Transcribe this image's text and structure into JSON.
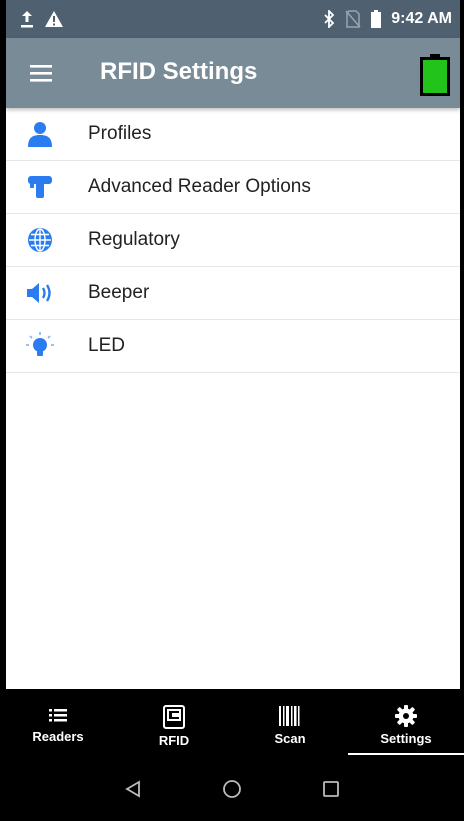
{
  "status_bar": {
    "time": "9:42 AM",
    "icons": [
      "upload-icon",
      "warning-icon",
      "bluetooth-icon",
      "no-sim-icon",
      "battery-icon"
    ]
  },
  "app_bar": {
    "title": "RFID Settings",
    "menu_icon": "hamburger-icon",
    "battery_icon": "battery-full-icon",
    "battery_color": "#22c31a"
  },
  "settings_list": [
    {
      "label": "Profiles",
      "icon": "profile-icon"
    },
    {
      "label": "Advanced Reader Options",
      "icon": "rfid-gun-icon"
    },
    {
      "label": "Regulatory",
      "icon": "globe-icon"
    },
    {
      "label": "Beeper",
      "icon": "speaker-icon"
    },
    {
      "label": "LED",
      "icon": "bulb-icon"
    }
  ],
  "bottom_nav": [
    {
      "label": "Readers",
      "icon": "list-icon",
      "active": false
    },
    {
      "label": "RFID",
      "icon": "rfid-icon",
      "active": false
    },
    {
      "label": "Scan",
      "icon": "barcode-icon",
      "active": false
    },
    {
      "label": "Settings",
      "icon": "gear-icon",
      "active": true
    }
  ],
  "system_nav": [
    "back-icon",
    "home-icon",
    "recents-icon"
  ],
  "colors": {
    "status_bar": "#4f6070",
    "app_bar": "#7a8b98",
    "icon_blue": "#2b7cf0",
    "nav_bg": "#000000"
  }
}
